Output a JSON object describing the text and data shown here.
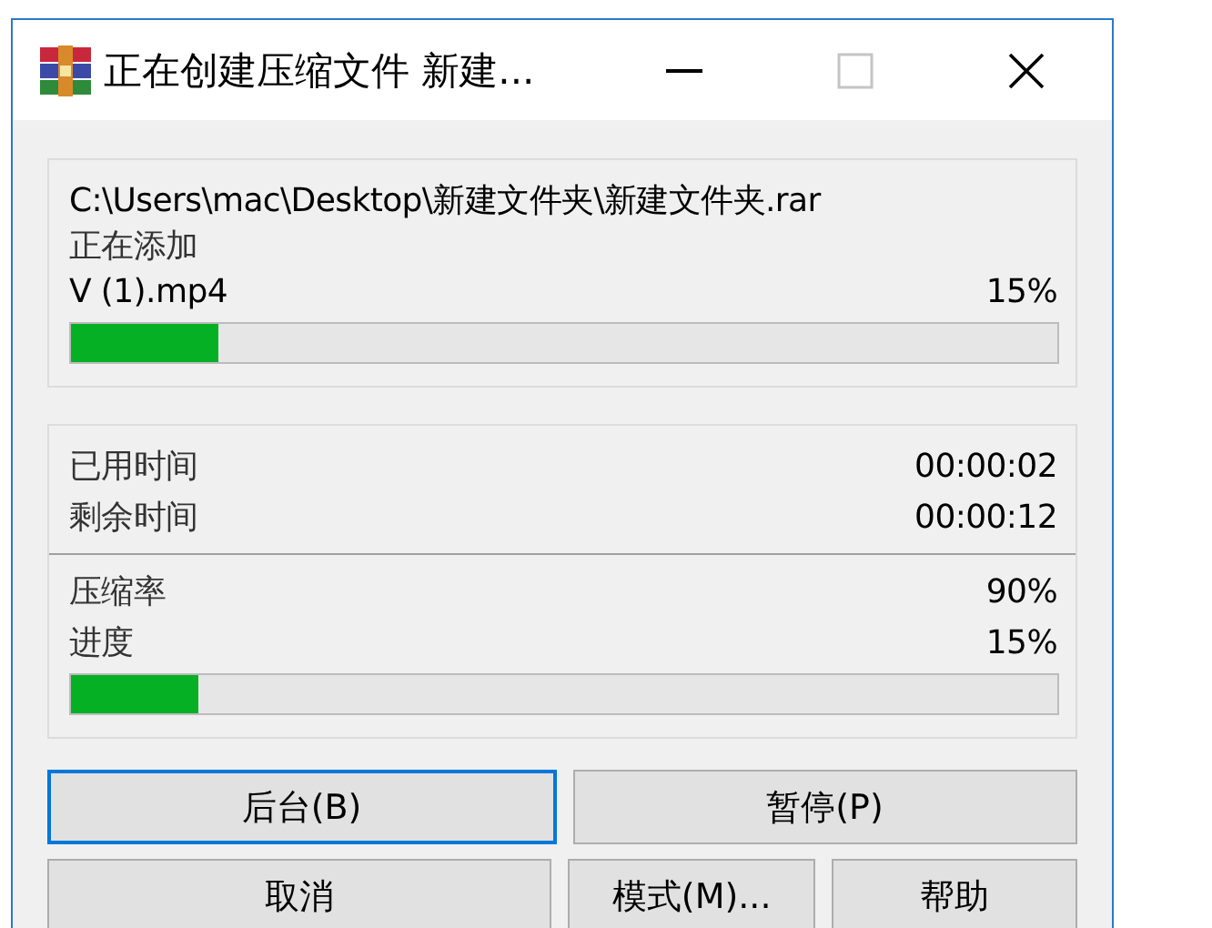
{
  "window": {
    "title": "正在创建压缩文件 新建...",
    "maximize_disabled": true
  },
  "archive": {
    "path": "C:\\Users\\mac\\Desktop\\新建文件夹\\新建文件夹.rar",
    "status": "正在添加",
    "file_name": "V (1).mp4",
    "percent": "15%",
    "level": 0.15
  },
  "stats": {
    "times": [
      {
        "label": "已用时间",
        "value": "00:00:02"
      },
      {
        "label": "剩余时间",
        "value": "00:00:12"
      }
    ],
    "ratio": {
      "label": "压缩率",
      "value": "90%"
    },
    "progress": {
      "label": "进度",
      "value": "15%",
      "level": 0.13
    }
  },
  "buttons": [
    [
      {
        "label": "后台(B)",
        "focused": true
      },
      {
        "label": "暂停(P)",
        "focused": false
      }
    ],
    [
      {
        "label": "取消",
        "focused": false
      },
      {
        "label": "模式(M)...",
        "focused": false
      },
      {
        "label": "帮助",
        "focused": false
      }
    ]
  ]
}
